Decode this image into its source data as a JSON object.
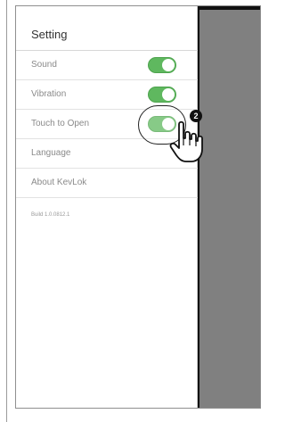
{
  "settings": {
    "title": "Setting",
    "items": [
      {
        "label": "Sound",
        "toggle": true,
        "on": true
      },
      {
        "label": "Vibration",
        "toggle": true,
        "on": true
      },
      {
        "label": "Touch to Open",
        "toggle": true,
        "on": true
      },
      {
        "label": "Language",
        "toggle": false
      },
      {
        "label": "About KevLok",
        "toggle": false
      }
    ],
    "build": "Build 1.0.0812.1"
  },
  "annotation": {
    "step": "2",
    "icons": [
      "hand-pointer-icon",
      "highlight-ring"
    ]
  },
  "colors": {
    "toggle_on": "#5fb85f",
    "overlay": "#808080"
  }
}
